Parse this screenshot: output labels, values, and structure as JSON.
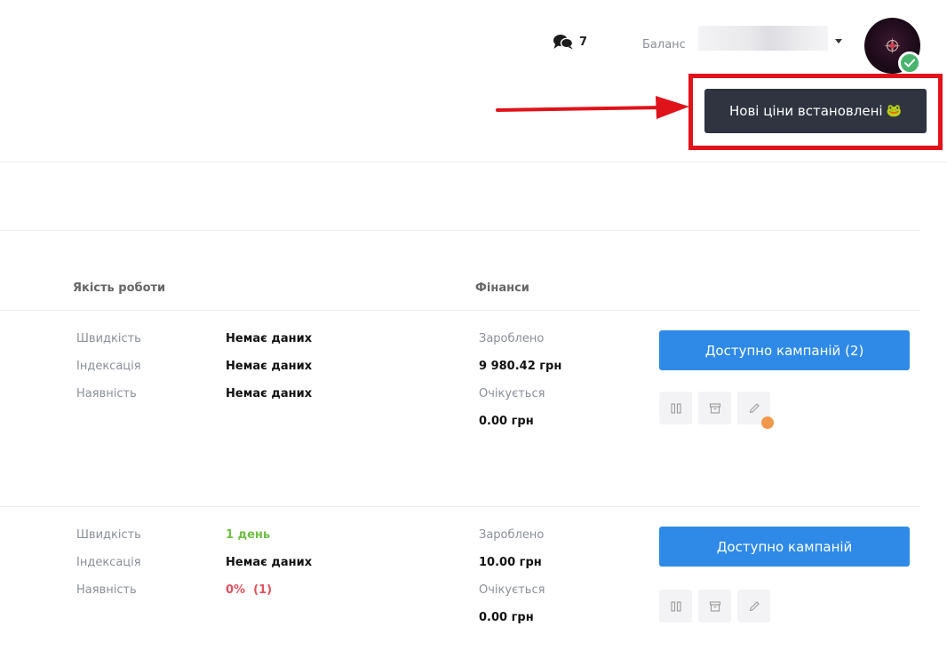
{
  "header": {
    "chat_count": "7",
    "balance_label": "Баланс"
  },
  "notification": {
    "text": "Нові ціни встановлені",
    "emoji": "🐸"
  },
  "columns": {
    "quality": "Якість роботи",
    "finance": "Фінанси"
  },
  "rows": [
    {
      "speed_label": "Швидкість",
      "speed_value": "Немає даних",
      "indexing_label": "Індексація",
      "indexing_value": "Немає даних",
      "availability_label": "Наявність",
      "availability_value": "Немає даних",
      "earned_label": "Зароблено",
      "earned_value": "9 980.42 грн",
      "expected_label": "Очікується",
      "expected_value": "0.00 грн",
      "campaign_button": "Доступно кампаній (2)"
    },
    {
      "speed_label": "Швидкість",
      "speed_value": "1 день",
      "indexing_label": "Індексація",
      "indexing_value": "Немає даних",
      "availability_label": "Наявність",
      "availability_value": "0%  (1)",
      "earned_label": "Зароблено",
      "earned_value": "10.00 грн",
      "expected_label": "Очікується",
      "expected_value": "0.00 грн",
      "campaign_button": "Доступно кампаній"
    }
  ],
  "icons": {
    "chat": "chat-bubbles-icon",
    "pause": "pause-icon",
    "archive": "archive-icon",
    "edit": "pencil-icon",
    "verified": "check-icon"
  },
  "colors": {
    "primary": "#2e8ae6",
    "toast_bg": "#2f3440",
    "highlight": "#e0121a",
    "success": "#6ebf43",
    "danger": "#e0505a",
    "badge": "#48b46e",
    "notify_dot": "#f2984a"
  }
}
